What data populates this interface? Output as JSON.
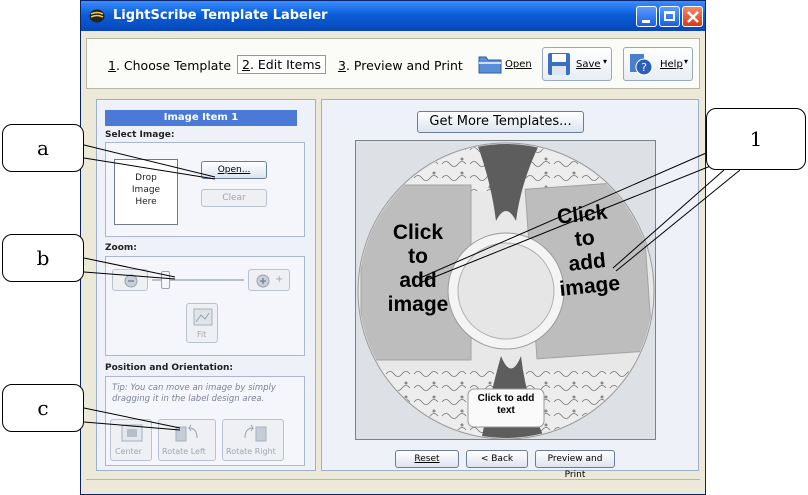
{
  "window": {
    "title": "LightScribe Template Labeler"
  },
  "steps": [
    {
      "num": "1",
      "label": ". Choose Template"
    },
    {
      "num": "2",
      "label": ". Edit Items"
    },
    {
      "num": "3",
      "label": ". Preview and Print"
    }
  ],
  "toolbar": {
    "open_label": "Open",
    "save_label": "Save",
    "help_label": "Help"
  },
  "left": {
    "header": "Image Item 1",
    "select_image_label": "Select Image:",
    "drop_text": "Drop\nImage\nHere",
    "open_button": "Open...",
    "clear_button": "Clear",
    "zoom_label": "Zoom:",
    "zoom_plus": "+",
    "fit_button": "Fit",
    "position_label": "Position and Orientation:",
    "tip": "Tip: You can move an image by simply dragging it in the label design area.",
    "center_button": "Center",
    "rotate_left_button": "Rotate Left",
    "rotate_right_button": "Rotate Right"
  },
  "right": {
    "get_more_button": "Get More Templates...",
    "click_add_left": "Click\nto\nadd\nimage",
    "click_add_right": "Click\nto\nadd\nimage",
    "click_add_text": "Click to add\ntext",
    "reset_button": "Reset",
    "back_button": "< Back",
    "preview_button": "Preview and Print"
  },
  "annotations": {
    "a": "a",
    "b": "b",
    "c": "c",
    "one": "1"
  }
}
